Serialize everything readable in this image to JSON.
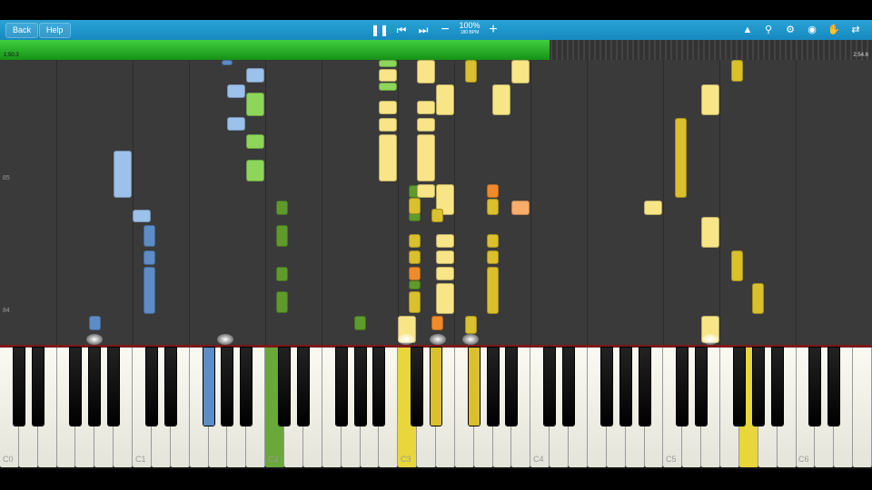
{
  "toolbar": {
    "back_label": "Back",
    "help_label": "Help",
    "tempo_percent": "100%",
    "tempo_bpm": "180 BPM",
    "icons": [
      "pause-icon",
      "skip-back-icon",
      "skip-forward-icon",
      "minus-icon",
      "plus-icon",
      "metronome-icon",
      "search-icon",
      "settings-icon",
      "pin-icon",
      "hand-icon",
      "loop-icon"
    ]
  },
  "progress": {
    "fraction": 0.63,
    "time_current": "1:50.3",
    "time_total": "2:54.6"
  },
  "roll": {
    "measure_labels": [
      "85",
      "84"
    ]
  },
  "keyboard": {
    "octave_labels": [
      "C0",
      "C1",
      "C2",
      "C3",
      "C4",
      "C5",
      "C6"
    ],
    "active_keys": [
      {
        "octave": 1,
        "note": "F#",
        "color": "#5d8cc7"
      },
      {
        "octave": 2,
        "note": "C",
        "color": "#6aa83a"
      },
      {
        "octave": 3,
        "note": "C",
        "color": "#e8d63c"
      },
      {
        "octave": 3,
        "note": "D#",
        "color": "#d9c02c"
      },
      {
        "octave": 3,
        "note": "F#",
        "color": "#d9c02c"
      },
      {
        "octave": 5,
        "note": "G",
        "color": "#e8d63c"
      }
    ]
  }
}
